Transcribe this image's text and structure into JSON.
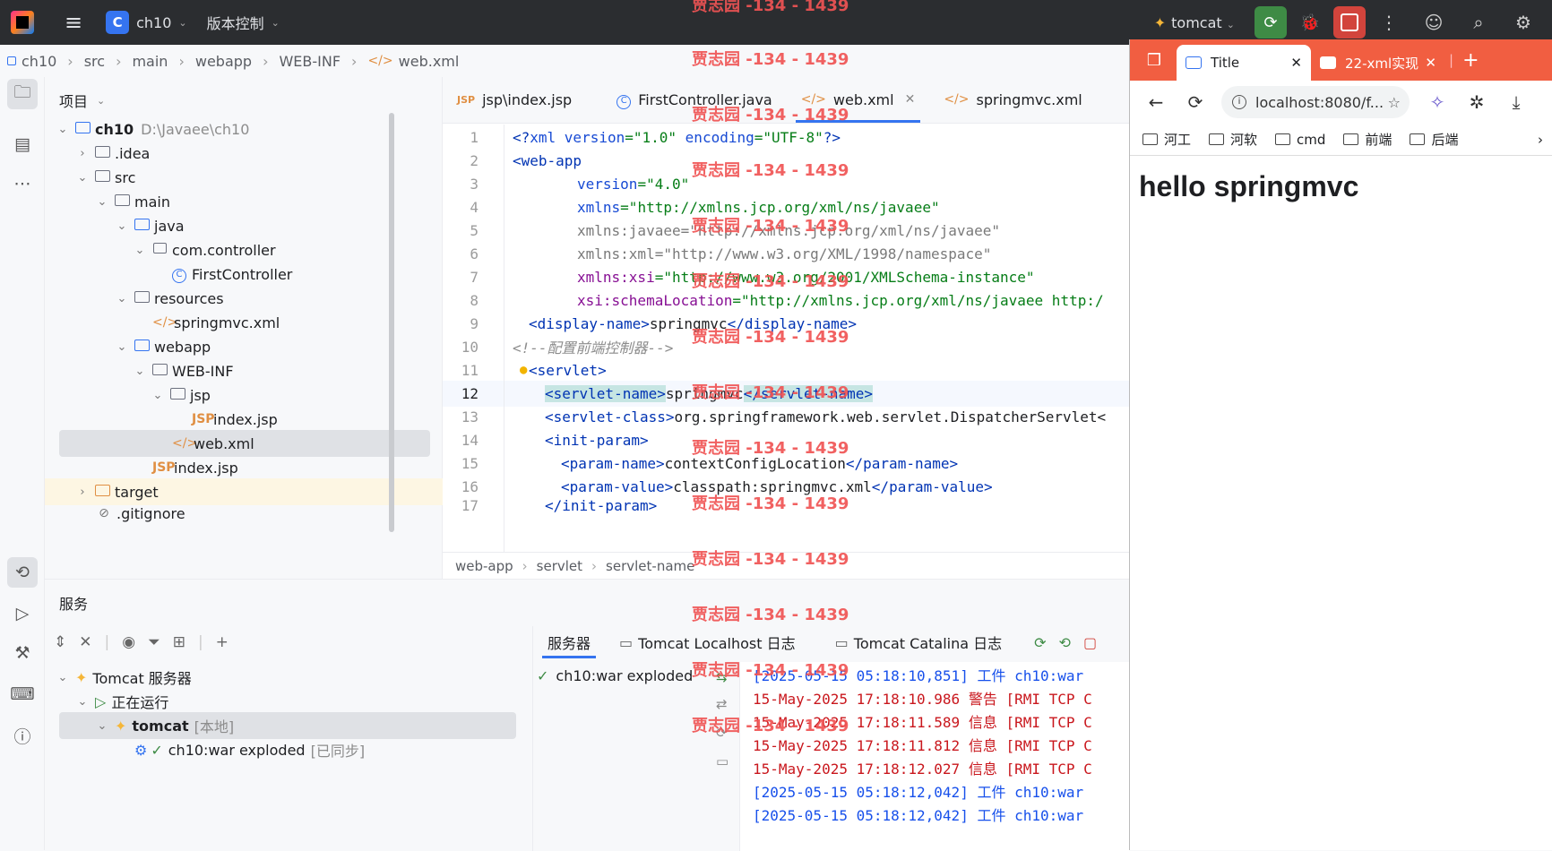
{
  "titlebar": {
    "project_badge": "C",
    "project_name": "ch10",
    "vcs_label": "版本控制",
    "run_config": "tomcat"
  },
  "breadcrumb": [
    "ch10",
    "src",
    "main",
    "webapp",
    "WEB-INF",
    "web.xml"
  ],
  "project_panel": {
    "title": "项目",
    "tree": [
      {
        "label": "ch10",
        "extra": "D:\\Javaee\\ch10",
        "icon": "module-folder-icon",
        "expanded": true
      },
      {
        "label": ".idea",
        "icon": "folder-icon",
        "expanded": false
      },
      {
        "label": "src",
        "icon": "folder-icon",
        "expanded": true
      },
      {
        "label": "main",
        "icon": "folder-icon",
        "expanded": true
      },
      {
        "label": "java",
        "icon": "source-folder-icon",
        "expanded": true
      },
      {
        "label": "com.controller",
        "icon": "package-icon",
        "expanded": true
      },
      {
        "label": "FirstController",
        "icon": "class-icon"
      },
      {
        "label": "resources",
        "icon": "resources-folder-icon",
        "expanded": true
      },
      {
        "label": "springmvc.xml",
        "icon": "xml-file-icon"
      },
      {
        "label": "webapp",
        "icon": "web-folder-icon",
        "expanded": true
      },
      {
        "label": "WEB-INF",
        "icon": "folder-icon",
        "expanded": true
      },
      {
        "label": "jsp",
        "icon": "folder-icon",
        "expanded": true
      },
      {
        "label": "index.jsp",
        "icon": "jsp-file-icon"
      },
      {
        "label": "web.xml",
        "icon": "xml-file-icon",
        "selected": true
      },
      {
        "label": "index.jsp",
        "icon": "jsp-file-icon"
      },
      {
        "label": "target",
        "icon": "excluded-folder-icon",
        "expanded": false
      },
      {
        "label": ".gitignore",
        "icon": "ignore-file-icon"
      }
    ]
  },
  "editor": {
    "tabs": [
      {
        "label": "jsp\\index.jsp",
        "icon": "jsp-file-icon"
      },
      {
        "label": "FirstController.java",
        "icon": "class-icon"
      },
      {
        "label": "web.xml",
        "icon": "xml-file-icon",
        "active": true
      },
      {
        "label": "springmvc.xml",
        "icon": "xml-file-icon"
      }
    ],
    "line_numbers": [
      "1",
      "2",
      "3",
      "4",
      "5",
      "6",
      "7",
      "8",
      "9",
      "10",
      "11",
      "12",
      "13",
      "14",
      "15",
      "16",
      "17"
    ],
    "current_line": "12",
    "lines": {
      "l1_a": "<?",
      "l1_b": "xml version",
      "l1_c": "=\"1.0\" ",
      "l1_d": "encoding",
      "l1_e": "=\"UTF-8\"",
      "l1_f": "?>",
      "l2": "<web-app",
      "l3_attr": "version",
      "l3_val": "=\"4.0\"",
      "l4_attr": "xmlns",
      "l4_val": "=\"http://xmlns.jcp.org/xml/ns/javaee\"",
      "l5": "xmlns:javaee=\"http://xmlns.jcp.org/xml/ns/javaee\"",
      "l6": "xmlns:xml=\"http://www.w3.org/XML/1998/namespace\"",
      "l7_attr": "xmlns:xsi",
      "l7_val": "=\"http://www.w3.org/2001/XMLSchema-instance\"",
      "l8_attr": "xsi:schemaLocation",
      "l8_val": "=\"http://xmlns.jcp.org/xml/ns/javaee http:/",
      "l9_open": "<display-name>",
      "l9_text": "springmvc",
      "l9_close": "</display-name>",
      "l10": "<!--配置前端控制器-->",
      "l11": "<servlet>",
      "l12_open": "<servlet-name>",
      "l12_text": "springmvc",
      "l12_close": "</servlet-name>",
      "l13_open": "<servlet-class>",
      "l13_text": "org.springframework.web.servlet.DispatcherServlet<",
      "l14": "<init-param>",
      "l15_open": "<param-name>",
      "l15_text": "contextConfigLocation",
      "l15_close": "</param-name>",
      "l16_open": "<param-value>",
      "l16_text": "classpath:springmvc.xml",
      "l16_close": "</param-value>",
      "l17": "</init-param>"
    },
    "crumbs": [
      "web-app",
      "servlet",
      "servlet-name"
    ]
  },
  "services": {
    "title": "服务",
    "tree": {
      "server": "Tomcat 服务器",
      "running": "正在运行",
      "tomcat": "tomcat",
      "tomcat_tag": "[本地]",
      "artifact": "ch10:war exploded",
      "artifact_tag": "[已同步]"
    },
    "tabs": [
      "服务器",
      "Tomcat Localhost 日志",
      "Tomcat Catalina 日志"
    ],
    "deployment": "ch10:war exploded",
    "log": [
      {
        "text": "[2025-05-15 05:18:10,851] 工件 ch10:war",
        "color": "#1750eb"
      },
      {
        "text": "15-May-2025 17:18:10.986 警告 [RMI TCP C",
        "color": "#c9171d"
      },
      {
        "text": "15-May-2025 17:18:11.589 信息 [RMI TCP C",
        "color": "#c9171d"
      },
      {
        "text": "15-May-2025 17:18:11.812 信息 [RMI TCP C",
        "color": "#c9171d"
      },
      {
        "text": "15-May-2025 17:18:12.027 信息 [RMI TCP C",
        "color": "#c9171d"
      },
      {
        "text": "[2025-05-15 05:18:12,042] 工件 ch10:war",
        "color": "#1750eb"
      },
      {
        "text": "[2025-05-15 05:18:12,042] 工件 ch10:war",
        "color": "#1750eb"
      }
    ]
  },
  "browser": {
    "tabs": [
      {
        "label": "Title",
        "active": true
      },
      {
        "label": "22-xml实现",
        "active": false
      }
    ],
    "url": "localhost:8080/f...",
    "bookmarks": [
      "河工",
      "河软",
      "cmd",
      "前端",
      "后端"
    ],
    "page_heading": "hello springmvc",
    "accent": "#f15e41"
  },
  "watermark": "贾志园 -134 - 1439"
}
